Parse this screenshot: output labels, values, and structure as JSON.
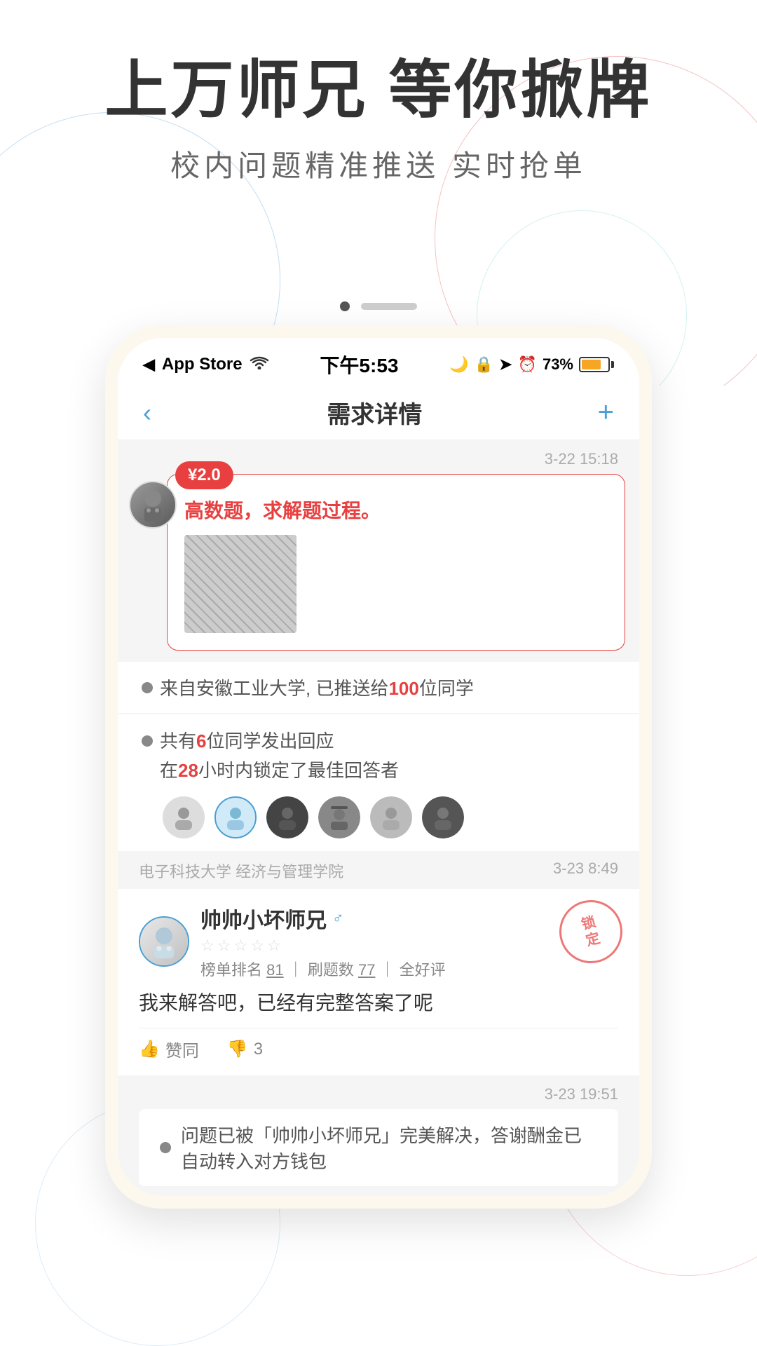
{
  "hero": {
    "title": "上万师兄 等你掀牌",
    "subtitle": "校内问题精准推送  实时抢单"
  },
  "pagination": {
    "dots": [
      {
        "active": true
      },
      {
        "active": false
      }
    ],
    "has_line": true
  },
  "status_bar": {
    "left_app": "App Store",
    "wifi_icon": "wifi",
    "time": "下午5:53",
    "moon_icon": "moon",
    "lock_icon": "lock",
    "location_icon": "location",
    "alarm_icon": "alarm",
    "battery_percent": "73%"
  },
  "nav": {
    "back": "‹",
    "title": "需求详情",
    "plus": "+"
  },
  "question": {
    "timestamp": "3-22 15:18",
    "price": "¥2.0",
    "text": "高数题，求解题过程。",
    "has_image": true
  },
  "info1": {
    "text_before": "来自安徽工业大学, 已推送给",
    "highlight": "100",
    "text_after": "位同学"
  },
  "info2": {
    "line1_before": "共有",
    "line1_highlight": "6",
    "line1_after": "位同学发出回应",
    "line2_before": "在",
    "line2_highlight": "28",
    "line2_after": "小时内锁定了最佳回答者"
  },
  "section_header": {
    "school": "电子科技大学  经济与管理学院",
    "timestamp": "3-23 8:49"
  },
  "answer": {
    "username": "帅帅小坏师兄",
    "gender_icon": "male",
    "stars": [
      false,
      false,
      false,
      false,
      false
    ],
    "meta": "榜单排名 81 ｜ 刷题数 77 ｜ 全好评",
    "meta_underline_1": "81",
    "meta_underline_2": "77",
    "text": "我来解答吧，已经有完整答案了呢",
    "lock_label": "锁定",
    "like_label": "赞同",
    "dislike_count": "3"
  },
  "final": {
    "timestamp": "3-23 19:51",
    "text_before": "问题已被「帅帅小坏师兄」完美解决，答谢酬金已自动转入对方钱包"
  },
  "avatars": [
    "🐱",
    "😺",
    "😸",
    "🎩",
    "😿",
    "😾"
  ]
}
